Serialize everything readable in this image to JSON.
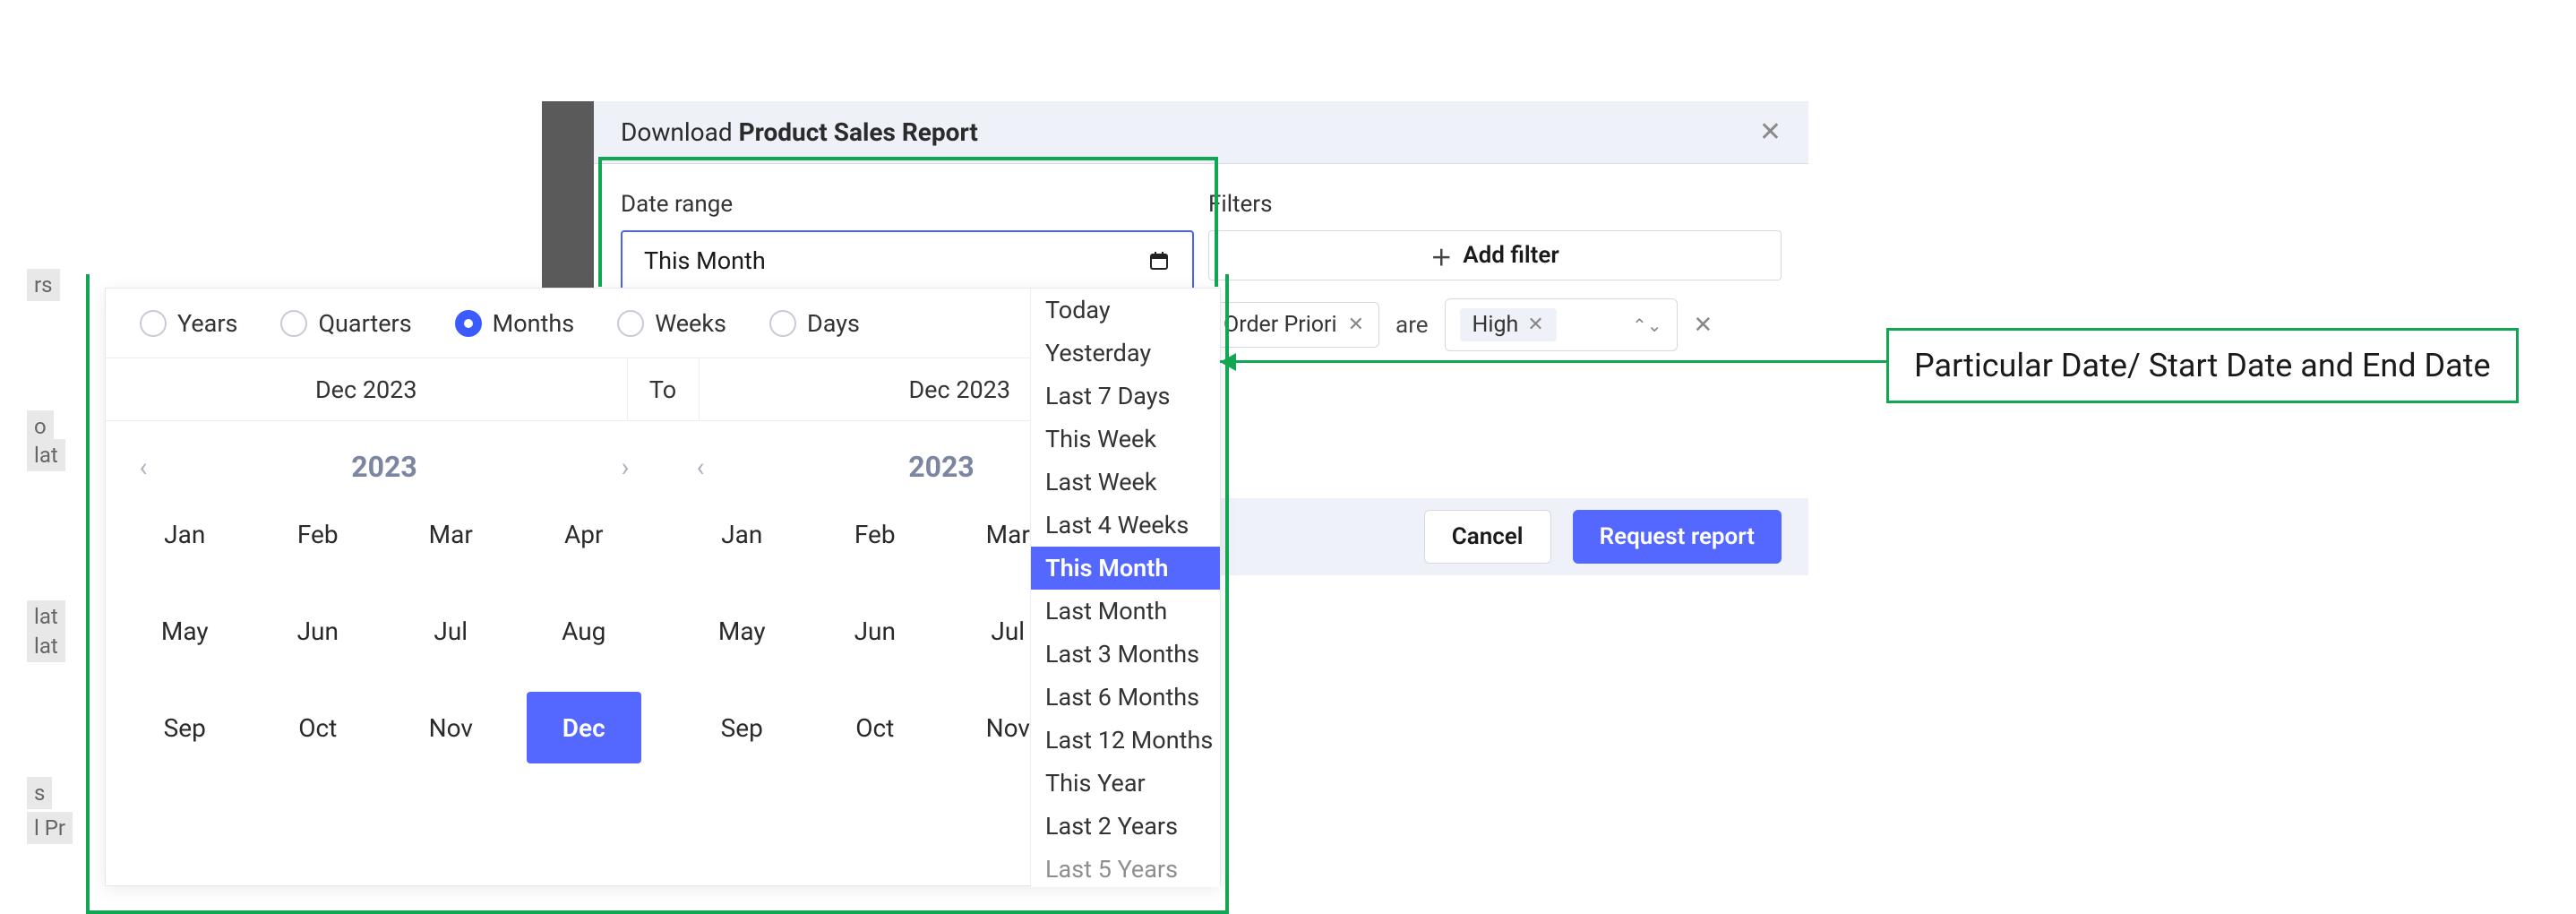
{
  "dialog": {
    "title_prefix": "Download ",
    "title_bold": "Product Sales Report",
    "date_label": "Date range",
    "date_value": "This Month",
    "filters_label": "Filters",
    "add_filter": "Add filter",
    "filter_field": "Order Priori",
    "filter_op": "are",
    "filter_value": "High",
    "cancel": "Cancel",
    "submit": "Request report"
  },
  "picker": {
    "tabs": [
      "Years",
      "Quarters",
      "Months",
      "Weeks",
      "Days"
    ],
    "selected_tab": "Months",
    "from": "Dec 2023",
    "to_label": "To",
    "to": "Dec 2023",
    "year": "2023",
    "months": [
      "Jan",
      "Feb",
      "Mar",
      "Apr",
      "May",
      "Jun",
      "Jul",
      "Aug",
      "Sep",
      "Oct",
      "Nov",
      "Dec"
    ],
    "selected_month": "Dec",
    "presets": [
      "Today",
      "Yesterday",
      "Last 7 Days",
      "This Week",
      "Last Week",
      "Last 4 Weeks",
      "This Month",
      "Last Month",
      "Last 3 Months",
      "Last 6 Months",
      "Last 12 Months",
      "This Year",
      "Last 2 Years",
      "Last 5 Years"
    ],
    "selected_preset": "This Month"
  },
  "annotation": "Particular Date/ Start Date and End Date",
  "stubs": {
    "s1": "rs",
    "s2": "o",
    "s3": "lat",
    "s4": "lat",
    "s5": "lat",
    "s6": "s",
    "s7": "l Pr"
  }
}
